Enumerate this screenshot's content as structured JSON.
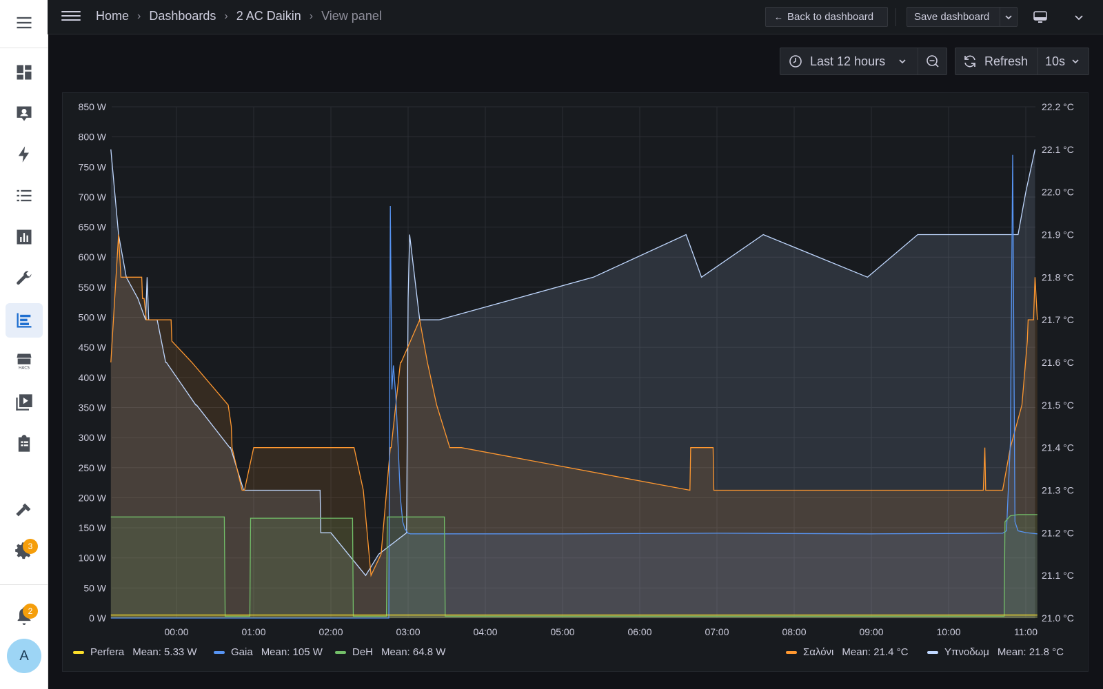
{
  "breadcrumb": [
    "Home",
    "Dashboards",
    "2 AC Daikin",
    "View panel"
  ],
  "toolbar": {
    "back_label": "Back to dashboard",
    "save_label": "Save dashboard",
    "time_range": "Last 12 hours",
    "refresh_label": "Refresh",
    "refresh_interval": "10s"
  },
  "sidebar": {
    "icons": [
      "overview-icon",
      "person-icon",
      "lightning-icon",
      "list-icon",
      "history-icon",
      "wrench-icon",
      "dashboards-icon",
      "hacs-icon",
      "media-icon",
      "todo-icon",
      "hammer-icon",
      "settings-icon",
      "notifications-icon"
    ],
    "settings_badge": "3",
    "notifications_badge": "2",
    "avatar_initial": "A"
  },
  "chart_data": {
    "type": "line",
    "title": "",
    "x_ticks": [
      "00:00",
      "01:00",
      "02:00",
      "03:00",
      "04:00",
      "05:00",
      "06:00",
      "07:00",
      "08:00",
      "09:00",
      "10:00",
      "11:00"
    ],
    "y_left": {
      "min": 0,
      "max": 850,
      "ticks": [
        "0 W",
        "50 W",
        "100 W",
        "150 W",
        "200 W",
        "250 W",
        "300 W",
        "350 W",
        "400 W",
        "450 W",
        "500 W",
        "550 W",
        "600 W",
        "650 W",
        "700 W",
        "750 W",
        "800 W",
        "850 W"
      ]
    },
    "y_right": {
      "min": 21.0,
      "max": 22.2,
      "ticks": [
        "21.0 °C",
        "21.1 °C",
        "21.2 °C",
        "21.3 °C",
        "21.4 °C",
        "21.5 °C",
        "21.6 °C",
        "21.7 °C",
        "21.8 °C",
        "21.9 °C",
        "22.0 °C",
        "22.1 °C",
        "22.2 °C"
      ]
    },
    "legend_placement": "bottom",
    "series": [
      {
        "name": "Perfera",
        "color": "#fade2a",
        "axis": "left",
        "mean": "Mean: 5.33 W",
        "x": [
          -0.85,
          11.15
        ],
        "y": [
          5,
          5
        ]
      },
      {
        "name": "Gaia",
        "color": "#5794f2",
        "axis": "left",
        "mean": "Mean: 105 W",
        "x": [
          -0.85,
          2.75,
          2.77,
          2.79,
          2.81,
          2.84,
          2.87,
          2.9,
          2.93,
          2.96,
          3.0,
          3.03,
          3.1,
          3.5,
          5.0,
          7.0,
          9.0,
          10.7,
          10.75,
          10.8,
          10.83,
          10.86,
          10.9,
          11.0,
          11.15
        ],
        "y": [
          0,
          0,
          685,
          380,
          420,
          370,
          290,
          200,
          160,
          148,
          141,
          140,
          140,
          140,
          140,
          141,
          140,
          141,
          145,
          290,
          770,
          160,
          145,
          142,
          140
        ]
      },
      {
        "name": "DeH",
        "color": "#73bf69",
        "axis": "left",
        "mean": "Mean: 64.8 W",
        "x": [
          -0.85,
          0.62,
          0.63,
          0.95,
          0.96,
          2.28,
          2.29,
          2.72,
          2.73,
          3.47,
          3.48,
          10.72,
          10.73,
          10.8,
          10.9,
          11.15
        ],
        "y": [
          168,
          168,
          3,
          3,
          166,
          166,
          3,
          3,
          168,
          168,
          3,
          3,
          160,
          170,
          172,
          172
        ]
      },
      {
        "name": "Σαλόνι",
        "color": "#ff9830",
        "axis": "right",
        "mean": "Mean: 21.4 °C",
        "x": [
          -0.85,
          -0.75,
          -0.72,
          -0.45,
          -0.44,
          -0.42,
          -0.39,
          -0.38,
          -0.07,
          -0.06,
          0.2,
          0.67,
          0.71,
          0.72,
          0.85,
          0.88,
          1.0,
          2.3,
          2.42,
          2.52,
          2.65,
          2.77,
          2.78,
          2.9,
          2.91,
          3.15,
          3.25,
          3.37,
          3.54,
          3.69,
          6.65,
          6.66,
          6.95,
          6.96,
          10.45,
          10.47,
          10.48,
          10.7,
          10.8,
          10.95,
          11.02,
          11.03,
          11.1,
          11.12,
          11.15
        ],
        "y": [
          21.6,
          21.9,
          21.8,
          21.8,
          21.75,
          21.75,
          21.7,
          21.7,
          21.7,
          21.65,
          21.6,
          21.5,
          21.45,
          21.4,
          21.3,
          21.3,
          21.4,
          21.4,
          21.3,
          21.1,
          21.15,
          21.4,
          21.4,
          21.6,
          21.6,
          21.7,
          21.6,
          21.5,
          21.4,
          21.4,
          21.3,
          21.4,
          21.4,
          21.3,
          21.3,
          21.4,
          21.3,
          21.3,
          21.4,
          21.5,
          21.65,
          21.7,
          21.7,
          21.8,
          21.7
        ]
      },
      {
        "name": "Υπνοδωμ",
        "color": "#c0d8ff",
        "axis": "right",
        "mean": "Mean: 21.8 °C",
        "x": [
          -0.85,
          -0.75,
          -0.65,
          -0.5,
          -0.4,
          -0.38,
          -0.37,
          -0.36,
          -0.25,
          -0.14,
          -0.13,
          0.25,
          0.26,
          0.69,
          0.7,
          0.87,
          0.88,
          1.86,
          1.87,
          2.0,
          2.45,
          2.62,
          2.98,
          3.0,
          3.02,
          3.15,
          3.4,
          5.4,
          6.6,
          6.8,
          7.6,
          8.95,
          9.6,
          10.05,
          10.9,
          11.0,
          11.12
        ],
        "y": [
          22.1,
          21.9,
          21.8,
          21.75,
          21.7,
          21.8,
          21.75,
          21.7,
          21.7,
          21.6,
          21.6,
          21.5,
          21.5,
          21.4,
          21.4,
          21.3,
          21.3,
          21.3,
          21.2,
          21.2,
          21.1,
          21.15,
          21.2,
          21.75,
          21.9,
          21.7,
          21.7,
          21.8,
          21.9,
          21.8,
          21.9,
          21.8,
          21.9,
          21.9,
          21.9,
          22.0,
          22.1
        ]
      }
    ]
  }
}
